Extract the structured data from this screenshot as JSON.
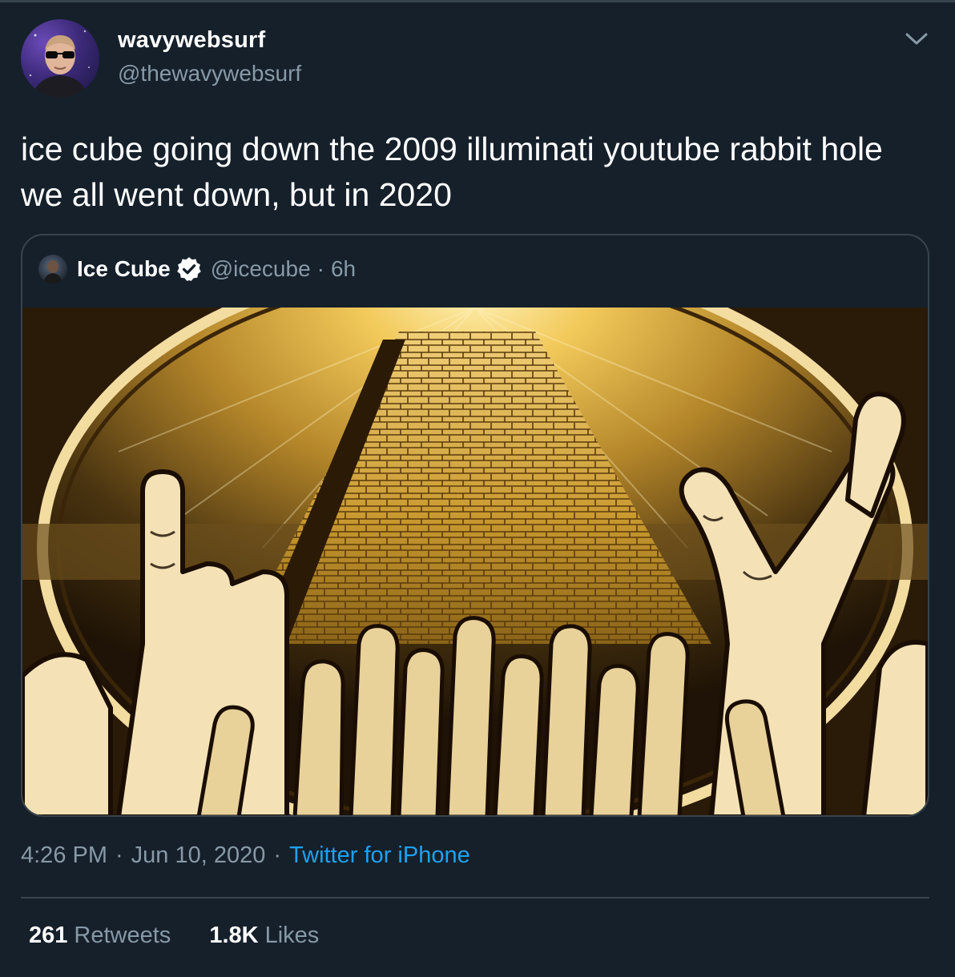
{
  "tweet": {
    "author": {
      "display_name": "wavywebsurf",
      "handle": "@thewavywebsurf",
      "avatar_icon": "sunglasses-person-avatar"
    },
    "menu_icon": "chevron-down-icon",
    "text": "ice cube going down the 2009 illuminati youtube rabbit hole we all went down, but in 2020",
    "quoted": {
      "display_name": "Ice Cube",
      "verified_icon": "verified-badge-icon",
      "handle": "@icecube",
      "separator": "·",
      "age": "6h",
      "image_icon": "illuminati-pyramid-hands-image"
    },
    "time": "4:26 PM",
    "date": "Jun 10, 2020",
    "separator": "·",
    "source": "Twitter for iPhone",
    "stats": {
      "retweets_count": "261",
      "retweets_label": "Retweets",
      "likes_count": "1.8K",
      "likes_label": "Likes"
    }
  },
  "colors": {
    "background": "#15202b",
    "border": "#38444d",
    "secondary_text": "#8899a6",
    "link": "#1da1f2",
    "verified": "#ffffff"
  }
}
